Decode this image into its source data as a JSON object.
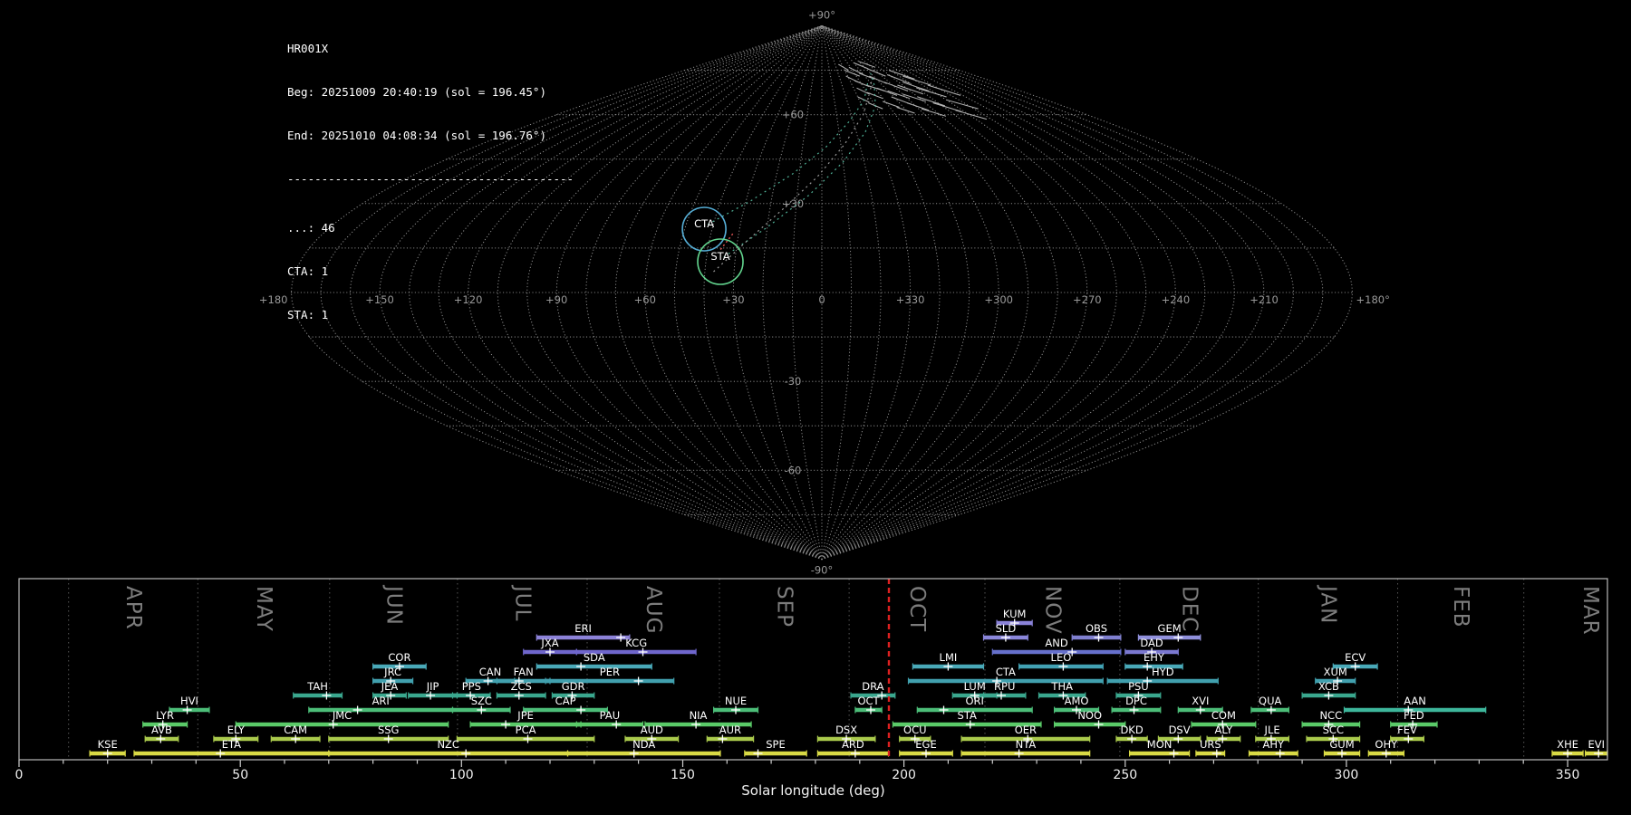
{
  "header": {
    "station": "HR001X",
    "beg": "Beg: 20251009 20:40:19 (sol = 196.45°)",
    "end": "End: 20251010 04:08:34 (sol = 196.76°)",
    "separator": "------------------------------------------",
    "count_sporadic": "...: 46",
    "count_cta": "CTA: 1",
    "count_sta": "STA: 1"
  },
  "map": {
    "grid_color": "#8c8c8c",
    "pole_top_label": "+90°",
    "pole_bottom_label": "-90°",
    "lat_labels": [
      {
        "lat": 60,
        "text": "+60"
      },
      {
        "lat": 30,
        "text": "+30"
      },
      {
        "lat": -30,
        "text": "-30"
      },
      {
        "lat": -60,
        "text": "-60"
      }
    ],
    "lon_labels": [
      {
        "offset": -180,
        "text": "+180"
      },
      {
        "offset": -150,
        "text": "+150"
      },
      {
        "offset": -120,
        "text": "+120"
      },
      {
        "offset": -90,
        "text": "+90"
      },
      {
        "offset": -60,
        "text": "+60"
      },
      {
        "offset": -30,
        "text": "+30"
      },
      {
        "offset": 0,
        "text": "0"
      },
      {
        "offset": 30,
        "text": "+330"
      },
      {
        "offset": 60,
        "text": "+300"
      },
      {
        "offset": 90,
        "text": "+270"
      },
      {
        "offset": 120,
        "text": "+240"
      },
      {
        "offset": 150,
        "text": "+210"
      },
      {
        "offset": 180,
        "text": "+180°"
      }
    ],
    "radiants": [
      {
        "code": "CTA",
        "lon": -42.9,
        "lat": 21.4,
        "r": 24,
        "color": "#56aed6"
      },
      {
        "code": "STA",
        "lon": -35.0,
        "lat": 10.4,
        "r": 25,
        "color": "#63d68f"
      }
    ],
    "meteor_segments": [
      [
        30,
        75,
        44,
        73
      ],
      [
        38,
        76,
        50,
        73.5
      ],
      [
        46,
        74,
        58,
        72
      ],
      [
        55,
        73,
        66,
        70.5
      ],
      [
        35,
        71.5,
        46,
        69.5
      ],
      [
        44,
        70,
        57,
        68
      ],
      [
        52,
        69,
        64,
        66.5
      ],
      [
        60,
        68,
        72,
        65.5
      ],
      [
        28,
        73,
        38,
        71
      ],
      [
        65,
        71,
        78,
        68
      ],
      [
        70,
        67,
        82,
        64.5
      ],
      [
        58,
        66,
        68,
        63.5
      ],
      [
        40,
        67.5,
        50,
        65.5
      ],
      [
        33,
        69,
        41,
        67
      ],
      [
        75,
        70,
        88,
        67
      ],
      [
        80,
        66,
        92,
        63
      ],
      [
        66,
        64,
        76,
        61.5
      ],
      [
        48,
        64.5,
        57,
        62.5
      ],
      [
        55,
        62.5,
        64,
        60.5
      ],
      [
        72,
        62,
        83,
        59.5
      ],
      [
        86,
        64,
        98,
        61
      ],
      [
        90,
        69,
        104,
        66
      ],
      [
        95,
        61.5,
        107,
        58.5
      ],
      [
        25,
        77,
        35,
        75
      ],
      [
        50,
        77.5,
        63,
        75.5
      ],
      [
        62,
        75.5,
        74,
        73
      ],
      [
        78,
        73.5,
        90,
        70.5
      ],
      [
        84,
        71,
        97,
        68
      ],
      [
        100,
        65,
        113,
        62
      ],
      [
        105,
        70,
        118,
        66.5
      ],
      [
        36,
        64,
        44,
        62
      ],
      [
        30,
        66,
        37,
        64.2
      ],
      [
        94,
        73,
        108,
        70
      ],
      [
        60,
        78,
        75,
        76
      ],
      [
        88,
        75,
        102,
        72
      ]
    ],
    "assoc_lines": [
      {
        "color": "#4faf95",
        "points": [
          [
            -34,
            12
          ],
          [
            -20,
            22
          ],
          [
            -5,
            33
          ],
          [
            10,
            44
          ],
          [
            25,
            54
          ],
          [
            40,
            63
          ],
          [
            52,
            70
          ],
          [
            60,
            74
          ]
        ]
      },
      {
        "color": "#4faf95",
        "points": [
          [
            -42,
            23
          ],
          [
            -28,
            31
          ],
          [
            -13,
            40
          ],
          [
            2,
            49
          ],
          [
            18,
            58
          ],
          [
            34,
            65
          ],
          [
            48,
            71
          ]
        ]
      },
      {
        "color": "#9a9a9a",
        "points": [
          [
            -37,
            7
          ],
          [
            -26,
            18
          ],
          [
            -14,
            29
          ],
          [
            -2,
            39
          ],
          [
            12,
            50
          ],
          [
            28,
            60
          ],
          [
            44,
            68
          ],
          [
            58,
            73
          ]
        ]
      }
    ],
    "red_trail": [
      [
        -35.5,
        14.5
      ],
      [
        -32,
        20
      ]
    ]
  },
  "chart_data": {
    "type": "timeline",
    "xlabel": "Solar longitude (deg)",
    "xlim": [
      0,
      359
    ],
    "x_major_ticks": [
      0,
      50,
      100,
      150,
      200,
      250,
      300,
      350
    ],
    "minor_tick_step": 10,
    "current_sol": 196.6,
    "current_sol_color": "#dd2020",
    "months": [
      {
        "label": "APR",
        "start": 11.2
      },
      {
        "label": "MAY",
        "start": 40.4
      },
      {
        "label": "JUN",
        "start": 70.2
      },
      {
        "label": "JUL",
        "start": 99.1
      },
      {
        "label": "AUG",
        "start": 128.4
      },
      {
        "label": "SEP",
        "start": 158.3
      },
      {
        "label": "OCT",
        "start": 187.6
      },
      {
        "label": "NOV",
        "start": 218.3
      },
      {
        "label": "DEC",
        "start": 248.8
      },
      {
        "label": "JAN",
        "start": 280.1
      },
      {
        "label": "FEB",
        "start": 311.6
      },
      {
        "label": "MAR",
        "start": 340.1
      }
    ],
    "showers": [
      {
        "code": "KUM",
        "row": 0,
        "start": 221,
        "end": 229,
        "peak": 225,
        "color": "#8a82d8"
      },
      {
        "code": "ERI",
        "row": 1,
        "start": 117,
        "end": 138,
        "peak": 136,
        "color": "#8c82d8"
      },
      {
        "code": "SLD",
        "row": 1,
        "start": 218,
        "end": 228,
        "peak": 223,
        "color": "#8a86da"
      },
      {
        "code": "OBS",
        "row": 1,
        "start": 238,
        "end": 249,
        "peak": 244,
        "color": "#8080d0"
      },
      {
        "code": "GEM",
        "row": 1,
        "start": 253,
        "end": 267,
        "peak": 262,
        "color": "#9090dc"
      },
      {
        "code": "JXA",
        "row": 2,
        "start": 114,
        "end": 126,
        "peak": 120,
        "color": "#6f66cc"
      },
      {
        "code": "KCG",
        "row": 2,
        "start": 126,
        "end": 153,
        "peak": 141,
        "color": "#6f66cc"
      },
      {
        "code": "AND",
        "row": 2,
        "start": 220,
        "end": 249,
        "peak": 238,
        "color": "#6670cc"
      },
      {
        "code": "DAD",
        "row": 2,
        "start": 250,
        "end": 262,
        "peak": 256,
        "color": "#7b78d0"
      },
      {
        "code": "COR",
        "row": 3,
        "start": 80,
        "end": 92,
        "peak": 86,
        "color": "#49a9b8"
      },
      {
        "code": "SDA",
        "row": 3,
        "start": 117,
        "end": 143,
        "peak": 127,
        "color": "#49a9b8"
      },
      {
        "code": "LMI",
        "row": 3,
        "start": 202,
        "end": 218,
        "peak": 210,
        "color": "#49a9b8"
      },
      {
        "code": "LEO",
        "row": 3,
        "start": 226,
        "end": 245,
        "peak": 236,
        "color": "#42a2b4"
      },
      {
        "code": "EHY",
        "row": 3,
        "start": 250,
        "end": 263,
        "peak": 255,
        "color": "#49a9b8"
      },
      {
        "code": "ECV",
        "row": 3,
        "start": 297,
        "end": 307,
        "peak": 302,
        "color": "#49a9b8"
      },
      {
        "code": "JRC",
        "row": 4,
        "start": 80,
        "end": 89,
        "peak": 84,
        "color": "#41a0ae"
      },
      {
        "code": "CAN",
        "row": 4,
        "start": 101,
        "end": 112,
        "peak": 106,
        "color": "#41a0ae"
      },
      {
        "code": "FAN",
        "row": 4,
        "start": 108,
        "end": 120,
        "peak": 113,
        "color": "#41a0ae"
      },
      {
        "code": "PER",
        "row": 4,
        "start": 119,
        "end": 148,
        "peak": 140,
        "color": "#41a0ae"
      },
      {
        "code": "CTA",
        "row": 4,
        "start": 201,
        "end": 245,
        "peak": 221,
        "color": "#41a0ae"
      },
      {
        "code": "HYD",
        "row": 4,
        "start": 246,
        "end": 271,
        "peak": 255,
        "color": "#41a0ae"
      },
      {
        "code": "XUM",
        "row": 4,
        "start": 293,
        "end": 302,
        "peak": 298,
        "color": "#41a0ae"
      },
      {
        "code": "TAH",
        "row": 5,
        "start": 62,
        "end": 73,
        "peak": 69.5,
        "color": "#3aa78e"
      },
      {
        "code": "JEA",
        "row": 5,
        "start": 80,
        "end": 87.5,
        "peak": 84,
        "color": "#3aa78e"
      },
      {
        "code": "JIP",
        "row": 5,
        "start": 88,
        "end": 99,
        "peak": 93,
        "color": "#3aa78e"
      },
      {
        "code": "PPS",
        "row": 5,
        "start": 98,
        "end": 106.5,
        "peak": 102,
        "color": "#3aa78e"
      },
      {
        "code": "ZCS",
        "row": 5,
        "start": 108,
        "end": 119,
        "peak": 113,
        "color": "#3aa78e"
      },
      {
        "code": "GDR",
        "row": 5,
        "start": 120.5,
        "end": 130,
        "peak": 125,
        "color": "#3aa78e"
      },
      {
        "code": "DRA",
        "row": 5,
        "start": 188,
        "end": 198,
        "peak": 195,
        "color": "#3aa78e"
      },
      {
        "code": "LUM",
        "row": 5,
        "start": 211,
        "end": 221,
        "peak": 216,
        "color": "#3aa78e"
      },
      {
        "code": "RPU",
        "row": 5,
        "start": 218,
        "end": 227.5,
        "peak": 222,
        "color": "#3aa78e"
      },
      {
        "code": "THA",
        "row": 5,
        "start": 230.5,
        "end": 241,
        "peak": 236,
        "color": "#3aa78e"
      },
      {
        "code": "PSU",
        "row": 5,
        "start": 248,
        "end": 258,
        "peak": 253,
        "color": "#3aa78e"
      },
      {
        "code": "XCB",
        "row": 5,
        "start": 290,
        "end": 302,
        "peak": 296,
        "color": "#3aa78e"
      },
      {
        "code": "HVI",
        "row": 6,
        "start": 34,
        "end": 43,
        "peak": 38,
        "color": "#4cbd78"
      },
      {
        "code": "ARI",
        "row": 6,
        "start": 65.5,
        "end": 98,
        "peak": 76.5,
        "color": "#4cbd78"
      },
      {
        "code": "SZC",
        "row": 6,
        "start": 98,
        "end": 111,
        "peak": 104.5,
        "color": "#4cbd78"
      },
      {
        "code": "CAP",
        "row": 6,
        "start": 114,
        "end": 133,
        "peak": 127,
        "color": "#4cbd78"
      },
      {
        "code": "NUE",
        "row": 6,
        "start": 157,
        "end": 167,
        "peak": 162,
        "color": "#4cbd78"
      },
      {
        "code": "OCT",
        "row": 6,
        "start": 189,
        "end": 195,
        "peak": 192.5,
        "color": "#4cbd78"
      },
      {
        "code": "ORI",
        "row": 6,
        "start": 203,
        "end": 229,
        "peak": 209,
        "color": "#4cbd78"
      },
      {
        "code": "AMO",
        "row": 6,
        "start": 234,
        "end": 244,
        "peak": 239,
        "color": "#4cbd78"
      },
      {
        "code": "DPC",
        "row": 6,
        "start": 247,
        "end": 258,
        "peak": 252,
        "color": "#4cbd78"
      },
      {
        "code": "XVI",
        "row": 6,
        "start": 262,
        "end": 272,
        "peak": 267,
        "color": "#4cbd78"
      },
      {
        "code": "QUA",
        "row": 6,
        "start": 278.5,
        "end": 287,
        "peak": 283,
        "color": "#4cbd78"
      },
      {
        "code": "AAN",
        "row": 6,
        "start": 299.5,
        "end": 331.5,
        "peak": 314,
        "color": "#3db69b"
      },
      {
        "code": "LYR",
        "row": 7,
        "start": 28,
        "end": 38,
        "peak": 32.5,
        "color": "#5aca68"
      },
      {
        "code": "JMC",
        "row": 7,
        "start": 49,
        "end": 97,
        "peak": 71,
        "color": "#5aca68"
      },
      {
        "code": "JPE",
        "row": 7,
        "start": 102,
        "end": 127,
        "peak": 110,
        "color": "#5aca68"
      },
      {
        "code": "PAU",
        "row": 7,
        "start": 126,
        "end": 141,
        "peak": 135,
        "color": "#5aca68"
      },
      {
        "code": "NIA",
        "row": 7,
        "start": 141.5,
        "end": 165.5,
        "peak": 153,
        "color": "#5aca68"
      },
      {
        "code": "STA",
        "row": 7,
        "start": 197.5,
        "end": 231,
        "peak": 215,
        "color": "#5aca68"
      },
      {
        "code": "NOO",
        "row": 7,
        "start": 234,
        "end": 250,
        "peak": 244,
        "color": "#5aca68"
      },
      {
        "code": "COM",
        "row": 7,
        "start": 265,
        "end": 279.5,
        "peak": 272,
        "color": "#5aca68"
      },
      {
        "code": "NCC",
        "row": 7,
        "start": 290,
        "end": 303,
        "peak": 296,
        "color": "#5aca68"
      },
      {
        "code": "FED",
        "row": 7,
        "start": 310,
        "end": 320.5,
        "peak": 315,
        "color": "#5aca68"
      },
      {
        "code": "AVB",
        "row": 8,
        "start": 28.5,
        "end": 36,
        "peak": 32,
        "color": "#aaca4c"
      },
      {
        "code": "ELY",
        "row": 8,
        "start": 44,
        "end": 54,
        "peak": 49,
        "color": "#aaca4c"
      },
      {
        "code": "CAM",
        "row": 8,
        "start": 57,
        "end": 68,
        "peak": 62.5,
        "color": "#aaca4c"
      },
      {
        "code": "SSG",
        "row": 8,
        "start": 70,
        "end": 97,
        "peak": 83.5,
        "color": "#aaca4c"
      },
      {
        "code": "PCA",
        "row": 8,
        "start": 99,
        "end": 130,
        "peak": 115,
        "color": "#aaca4c"
      },
      {
        "code": "AUD",
        "row": 8,
        "start": 137,
        "end": 149,
        "peak": 143,
        "color": "#aaca4c"
      },
      {
        "code": "AUR",
        "row": 8,
        "start": 155.5,
        "end": 166,
        "peak": 159,
        "color": "#aaca4c"
      },
      {
        "code": "DSX",
        "row": 8,
        "start": 180.5,
        "end": 193.5,
        "peak": 187,
        "color": "#aaca4c"
      },
      {
        "code": "OCU",
        "row": 8,
        "start": 199,
        "end": 206,
        "peak": 202.5,
        "color": "#aaca4c"
      },
      {
        "code": "OER",
        "row": 8,
        "start": 213,
        "end": 242,
        "peak": 228,
        "color": "#aaca4c"
      },
      {
        "code": "DKD",
        "row": 8,
        "start": 248,
        "end": 255,
        "peak": 251.5,
        "color": "#aaca4c"
      },
      {
        "code": "DSV",
        "row": 8,
        "start": 257.5,
        "end": 267,
        "peak": 262,
        "color": "#aaca4c"
      },
      {
        "code": "ALY",
        "row": 8,
        "start": 268.5,
        "end": 276,
        "peak": 272,
        "color": "#aaca4c"
      },
      {
        "code": "JLE",
        "row": 8,
        "start": 279.5,
        "end": 287,
        "peak": 283,
        "color": "#aaca4c"
      },
      {
        "code": "SCC",
        "row": 8,
        "start": 291,
        "end": 303,
        "peak": 297,
        "color": "#aaca4c"
      },
      {
        "code": "FEV",
        "row": 8,
        "start": 310,
        "end": 317.5,
        "peak": 314,
        "color": "#aaca4c"
      },
      {
        "code": "KSE",
        "row": 9,
        "start": 16,
        "end": 24,
        "peak": 20,
        "color": "#d9da45"
      },
      {
        "code": "ETA",
        "row": 9,
        "start": 26,
        "end": 70,
        "peak": 45.5,
        "color": "#d9da45"
      },
      {
        "code": "NZC",
        "row": 9,
        "start": 70,
        "end": 124,
        "peak": 101,
        "color": "#d9da45"
      },
      {
        "code": "NDA",
        "row": 9,
        "start": 124,
        "end": 158.5,
        "peak": 139,
        "color": "#d9da45"
      },
      {
        "code": "SPE",
        "row": 9,
        "start": 164,
        "end": 178,
        "peak": 167,
        "color": "#d9da45"
      },
      {
        "code": "ARD",
        "row": 9,
        "start": 180.5,
        "end": 196.5,
        "peak": 189,
        "color": "#d9da45"
      },
      {
        "code": "EGE",
        "row": 9,
        "start": 199,
        "end": 211,
        "peak": 205,
        "color": "#d9da45"
      },
      {
        "code": "NTA",
        "row": 9,
        "start": 213,
        "end": 242,
        "peak": 226,
        "color": "#d9da45"
      },
      {
        "code": "MON",
        "row": 9,
        "start": 251,
        "end": 264.5,
        "peak": 261,
        "color": "#d9da45"
      },
      {
        "code": "URS",
        "row": 9,
        "start": 266,
        "end": 272.5,
        "peak": 270.7,
        "color": "#d9da45"
      },
      {
        "code": "AHY",
        "row": 9,
        "start": 278,
        "end": 289,
        "peak": 285,
        "color": "#d9da45"
      },
      {
        "code": "GUM",
        "row": 9,
        "start": 295,
        "end": 303,
        "peak": 299,
        "color": "#d9da45"
      },
      {
        "code": "OHY",
        "row": 9,
        "start": 305,
        "end": 313,
        "peak": 309,
        "color": "#d9da45"
      },
      {
        "code": "XHE",
        "row": 9,
        "start": 346.5,
        "end": 353.5,
        "peak": 350,
        "color": "#d9da45"
      },
      {
        "code": "EVI",
        "row": 9,
        "start": 354,
        "end": 359,
        "peak": 357,
        "color": "#d9da45"
      }
    ]
  }
}
